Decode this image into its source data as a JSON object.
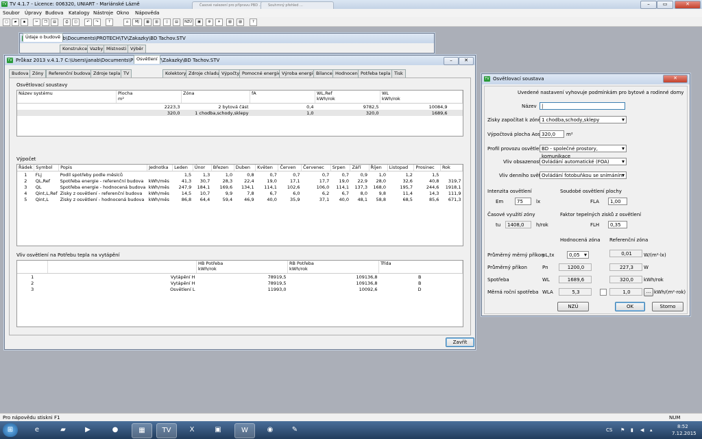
{
  "main_title": "TV 4.1.7 - Licence: 006320,  UNIART - Mariánské Lázně",
  "browser_tab_1": "Časové nalezení pro přípravu PBD ...",
  "browser_tab_2": "Souhrnný přehled ...",
  "menu": [
    "Soubor",
    "Úpravy",
    "Budova",
    "Katalogy",
    "Nástroje",
    "Okno",
    "Nápověda"
  ],
  "toolbar": {
    "nzu": "NZÚ",
    "mj": "MJ"
  },
  "back_window": {
    "title": "C:\\Users\\janab\\Documents\\PROTECH\\TV\\Zakazky\\BD Tachov.STV",
    "tabs": [
      "Údaje o budově",
      "Konstrukce",
      "Vazby",
      "Místnosti",
      "Výběr"
    ]
  },
  "front_window": {
    "title": "Průkaz 2013  v.4.1.7     C:\\Users\\janab\\Documents\\PROTECH\\TV\\Zakazky\\BD Tachov.STV",
    "tabs": [
      "Budova",
      "Zóny",
      "Referenční budova",
      "Zdroje tepla",
      "TV",
      "Osvětlení",
      "Kolektory",
      "Zdroje chladu",
      "Výpočty",
      "Pomocné energie",
      "Výroba energie",
      "Bilance",
      "Hodnocení",
      "Potřeba tepla",
      "Tisk"
    ],
    "section1": {
      "title": "Osvětlovací soustavy",
      "headers": [
        "Název systému",
        "Plocha",
        "m²",
        "Zóna",
        "fA",
        "WL,Ref",
        "kWh/rok",
        "WL",
        "kWh/rok"
      ],
      "rows": [
        [
          "",
          "2223,3",
          "2 bytová část",
          "0,4",
          "9782,5",
          "10084,9"
        ],
        [
          "",
          "320,0",
          "1 chodba,schody,sklepy",
          "1,0",
          "320,0",
          "1689,6"
        ]
      ]
    },
    "section2": {
      "title": "Výpočet",
      "headers": [
        "Řádek",
        "Symbol",
        "Popis",
        "Jednotka",
        "Leden",
        "Únor",
        "Březen",
        "Duben",
        "Květen",
        "Červen",
        "Červenec",
        "Srpen",
        "Září",
        "Říjen",
        "Listopad",
        "Prosinec",
        "Rok"
      ],
      "rows": [
        [
          "1",
          "FLj",
          "Podíl spotřeby podle měsíců",
          "",
          "1,5",
          "1,3",
          "1,0",
          "0,8",
          "0,7",
          "0,7",
          "0,7",
          "0,7",
          "0,9",
          "1,0",
          "1,2",
          "1,5",
          ""
        ],
        [
          "2",
          "QL,Ref",
          "Spotřeba energie - referenční budova",
          "kWh/měs",
          "41,3",
          "30,7",
          "28,3",
          "22,4",
          "19,0",
          "17,1",
          "17,7",
          "19,0",
          "22,9",
          "28,0",
          "32,6",
          "40,8",
          "319,7"
        ],
        [
          "3",
          "QL",
          "Spotřeba energie - hodnocená budova",
          "kWh/měs",
          "247,9",
          "184,1",
          "169,6",
          "134,1",
          "114,1",
          "102,6",
          "106,0",
          "114,1",
          "137,3",
          "168,0",
          "195,7",
          "244,6",
          "1918,1"
        ],
        [
          "4",
          "Qint,L,Ref",
          "Zisky z osvětlení - referenční budova",
          "kWh/měs",
          "14,5",
          "10,7",
          "9,9",
          "7,8",
          "6,7",
          "6,0",
          "6,2",
          "6,7",
          "8,0",
          "9,8",
          "11,4",
          "14,3",
          "111,9"
        ],
        [
          "5",
          "Qint,L",
          "Zisky z osvětlení - hodnocená budova",
          "kWh/měs",
          "86,8",
          "64,4",
          "59,4",
          "46,9",
          "40,0",
          "35,9",
          "37,1",
          "40,0",
          "48,1",
          "58,8",
          "68,5",
          "85,6",
          "671,3"
        ]
      ]
    },
    "section3": {
      "title": "Vliv osvětlení na Potřebu tepla na vytápění",
      "headers": [
        "HB Potřeba",
        "kWh/rok",
        "RB Potřeba",
        "kWh/rok",
        "Třída"
      ],
      "rows": [
        [
          "1",
          "Vytápění H",
          "78919,5",
          "109136,8",
          "B"
        ],
        [
          "2",
          "Vytápění H",
          "78919,5",
          "109136,8",
          "B"
        ],
        [
          "3",
          "Osvětlení L",
          "11993,0",
          "10092,6",
          "D"
        ]
      ]
    },
    "close_button": "Zavřít"
  },
  "dialog": {
    "title": "Osvětlovací soustava",
    "notice": "Uvedené nastavení vyhovuje podmínkám pro bytové a rodinné domy",
    "name_label": "Název",
    "name_value": "",
    "gains_label": "Zisky započítat k zóně",
    "gains_value": "1 chodba,schody,sklepy",
    "area_label": "Výpočtová plocha Aos",
    "area_value": "320,0",
    "area_unit": "m²",
    "profile_label": "Profil provozu osvětlení",
    "profile_value": "BD - společné prostory, komunikace",
    "occupancy_label": "Vliv obsazenosti",
    "occupancy_value": "Ovládání automatické (FOA)",
    "daylight_label": "Vliv denního světla",
    "daylight_value": "Ovládání fotobuňkou se snímáním (FDF",
    "intensity_title": "Intenzita osvětlení",
    "em_label": "Em",
    "em_value": "75",
    "em_unit": "lx",
    "simult_title": "Soudobé osvětlení plochy",
    "fla_label": "FLA",
    "fla_value": "1,00",
    "time_title": "Časové využití zóny",
    "tu_label": "tu",
    "tu_value": "1408,0",
    "tu_unit": "h/rok",
    "heat_title": "Faktor tepelných zisků z osvětlení",
    "flh_label": "FLH",
    "flh_value": "0,35",
    "col_hz": "Hodnocená zóna",
    "col_rz": "Referenční zóna",
    "r1_label": "Průměrný měrný příkon",
    "r1_sym": "pL,tx",
    "r1_hz": "0,05",
    "r1_rz": "0,01",
    "r1_unit": "W/(m²·lx)",
    "r2_label": "Průměrný příkon",
    "r2_sym": "Pn",
    "r2_hz": "1200,0",
    "r2_rz": "227,3",
    "r2_unit": "W",
    "r3_label": "Spotřeba",
    "r3_sym": "WL",
    "r3_hz": "1689,6",
    "r3_rz": "320,0",
    "r3_unit": "kWh/rok",
    "r4_label": "Měrná roční spotřeba",
    "r4_sym": "WLA",
    "r4_hz": "5,3",
    "r4_rz": "1,0",
    "r4_unit": "kWh/(m²·rok)",
    "browse": "...",
    "nzu_button": "NZÚ",
    "ok_button": "OK",
    "cancel_button": "Storno"
  },
  "status_left": "Pro nápovědu stiskni  F1",
  "status_right": "NUM",
  "tray": {
    "lang": "CS",
    "time": "8:52",
    "date": "7.12.2015"
  }
}
